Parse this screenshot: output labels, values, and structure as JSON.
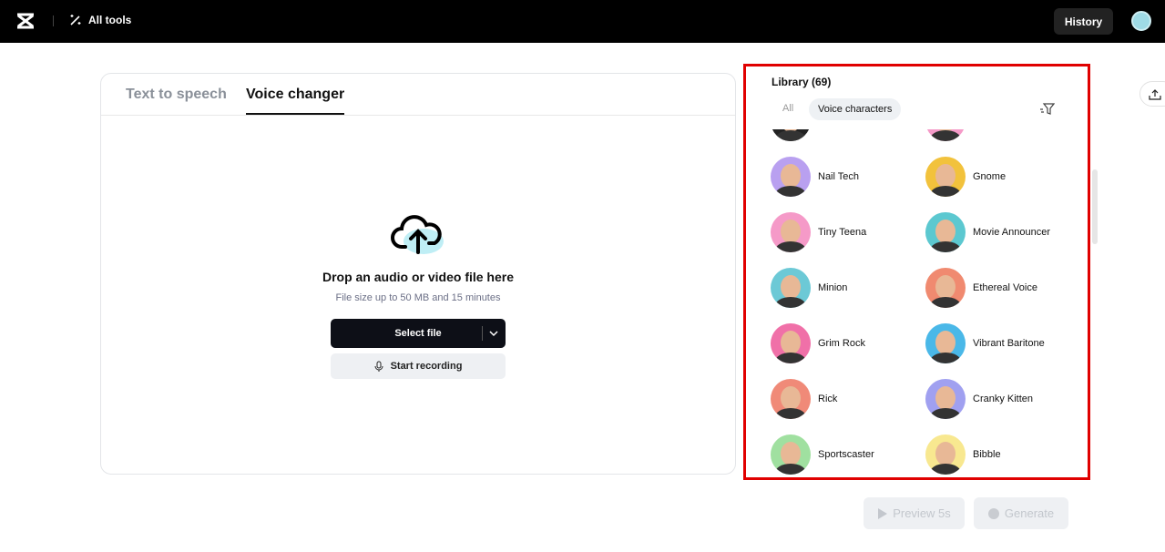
{
  "topbar": {
    "all_tools": "All tools",
    "history": "History"
  },
  "tabs": [
    {
      "label": "Text to speech"
    },
    {
      "label": "Voice changer"
    }
  ],
  "upload": {
    "title": "Drop an audio or video file here",
    "hint": "File size up to 50 MB and 15 minutes",
    "select": "Select file",
    "record": "Start recording"
  },
  "library": {
    "title": "Library (69)",
    "chip_all": "All",
    "chip_active": "Voice characters",
    "voices": [
      {
        "name": "",
        "color": "#222222"
      },
      {
        "name": "",
        "color": "#f59ac8"
      },
      {
        "name": "Nail Tech",
        "color": "#b9a0f0"
      },
      {
        "name": "Gnome",
        "color": "#f2c23c"
      },
      {
        "name": "Tiny Teena",
        "color": "#f59ac8"
      },
      {
        "name": "Movie Announcer",
        "color": "#5cc8d0"
      },
      {
        "name": "Minion",
        "color": "#6cc9d6"
      },
      {
        "name": "Ethereal Voice",
        "color": "#f08a70"
      },
      {
        "name": "Grim Rock",
        "color": "#f070a8"
      },
      {
        "name": "Vibrant Baritone",
        "color": "#4ab8e8"
      },
      {
        "name": "Rick",
        "color": "#f08a78"
      },
      {
        "name": "Cranky Kitten",
        "color": "#a0a0f0"
      },
      {
        "name": "Sportscaster",
        "color": "#a0e0a0"
      },
      {
        "name": "Bibble",
        "color": "#f8e890"
      }
    ]
  },
  "footer": {
    "preview": "Preview 5s",
    "generate": "Generate"
  }
}
